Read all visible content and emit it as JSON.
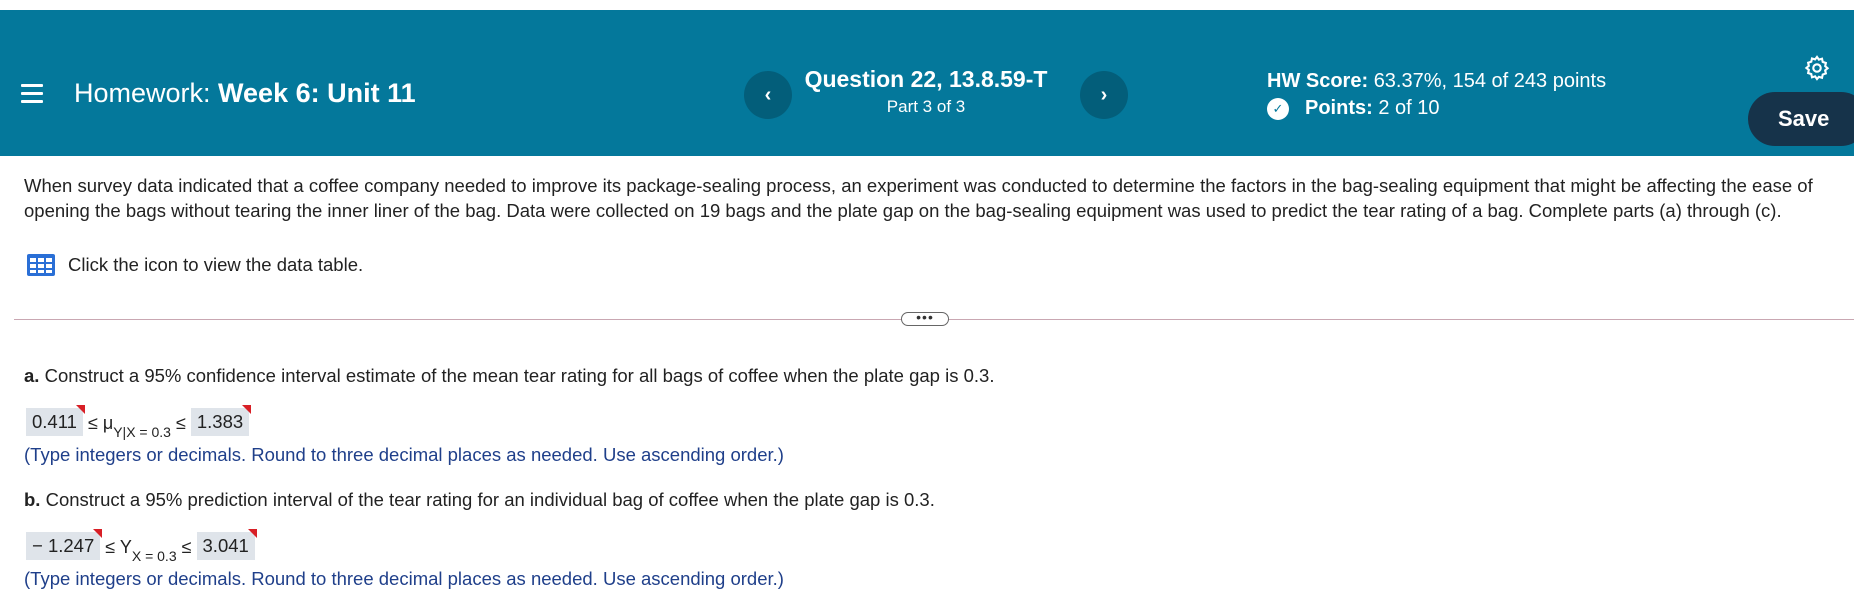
{
  "header": {
    "hw_prefix": "Homework:",
    "hw_name": "Week 6: Unit 11",
    "question_title": "Question 22, 13.8.59-T",
    "question_part": "Part 3 of 3",
    "prev_label": "‹",
    "next_label": "›",
    "score_label": "HW Score:",
    "score_value": "63.37%, 154 of 243 points",
    "points_label": "Points:",
    "points_value": "2 of 10",
    "save_label": "Save",
    "colors": {
      "banner": "#04789b",
      "save_button": "#16334a"
    }
  },
  "problem": {
    "intro": "When survey data indicated that a coffee company needed to improve its package-sealing process, an experiment was conducted to determine the factors in the bag-sealing equipment that might be affecting the ease of opening the bags without tearing the inner liner of the bag. Data were collected on 19 bags and the plate gap on the bag-sealing equipment was used to predict the tear rating of a bag. Complete parts (a) through (c).",
    "data_link": "Click the icon to view the data table.",
    "more_label": "•••"
  },
  "part_a": {
    "letter": "a.",
    "question": "Construct a 95% confidence interval estimate of the mean tear rating for all bags of coffee when the plate gap is 0.3.",
    "lower": "0.411",
    "le1": "≤",
    "symbol": "μ",
    "subscript": "Y|X = 0.3",
    "le2": "≤",
    "upper": "1.383",
    "hint": "(Type integers or decimals. Round to three decimal places as needed. Use ascending order.)"
  },
  "part_b": {
    "letter": "b.",
    "question": "Construct a 95% prediction interval of the tear rating for an individual bag of coffee when the plate gap is 0.3.",
    "lower": "− 1.247",
    "le1": "≤",
    "symbol": "Y",
    "subscript": "X = 0.3",
    "le2": "≤",
    "upper": "3.041",
    "hint": "(Type integers or decimals. Round to three decimal places as needed. Use ascending order.)"
  }
}
